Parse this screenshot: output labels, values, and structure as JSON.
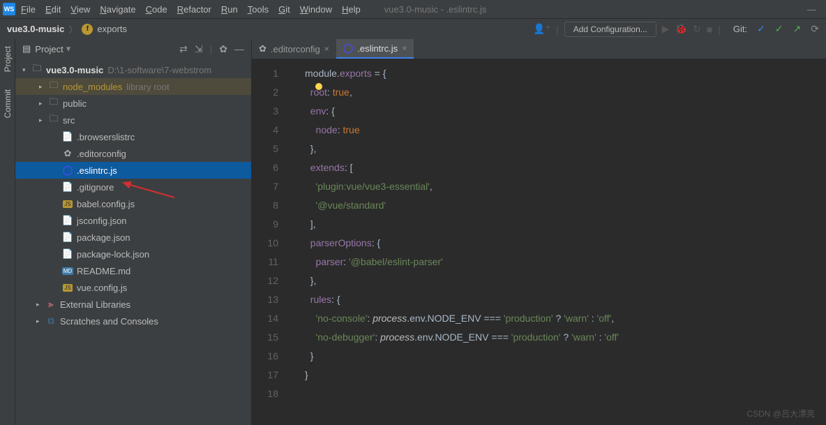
{
  "menubar": {
    "items": [
      "File",
      "Edit",
      "View",
      "Navigate",
      "Code",
      "Refactor",
      "Run",
      "Tools",
      "Git",
      "Window",
      "Help"
    ],
    "title": "vue3.0-music - .eslintrc.js"
  },
  "nav": {
    "project": "vue3.0-music",
    "symbol": "exports",
    "addconfig": "Add Configuration...",
    "git": "Git:"
  },
  "sidebar": {
    "tabs": [
      "Project",
      "Commit"
    ]
  },
  "project": {
    "header": "Project",
    "root": {
      "name": "vue3.0-music",
      "path": "D:\\1-software\\7-webstrom"
    },
    "children": [
      {
        "name": "node_modules",
        "suffix": "library root",
        "type": "dir-lib"
      },
      {
        "name": "public",
        "type": "dir"
      },
      {
        "name": "src",
        "type": "dir"
      },
      {
        "name": ".browserslistrc",
        "type": "file"
      },
      {
        "name": ".editorconfig",
        "type": "gear"
      },
      {
        "name": ".eslintrc.js",
        "type": "eslint",
        "selected": true
      },
      {
        "name": ".gitignore",
        "type": "file"
      },
      {
        "name": "babel.config.js",
        "type": "js"
      },
      {
        "name": "jsconfig.json",
        "type": "json"
      },
      {
        "name": "package.json",
        "type": "json"
      },
      {
        "name": "package-lock.json",
        "type": "json"
      },
      {
        "name": "README.md",
        "type": "md"
      },
      {
        "name": "vue.config.js",
        "type": "js"
      }
    ],
    "extras": [
      "External Libraries",
      "Scratches and Consoles"
    ]
  },
  "tabs": [
    {
      "name": ".editorconfig",
      "icon": "gear"
    },
    {
      "name": ".eslintrc.js",
      "icon": "eslint",
      "active": true
    }
  ],
  "code": {
    "lines": [
      [
        {
          "t": "module",
          "c": "id"
        },
        {
          "t": ".",
          "c": "op"
        },
        {
          "t": "exports",
          "c": "prop"
        },
        {
          "t": " = {",
          "c": "op"
        }
      ],
      [
        {
          "t": "  root",
          "c": "prop"
        },
        {
          "t": ": ",
          "c": "op"
        },
        {
          "t": "true",
          "c": "kw"
        },
        {
          "t": ",",
          "c": "op"
        }
      ],
      [
        {
          "t": "  env",
          "c": "prop"
        },
        {
          "t": ": {",
          "c": "op"
        }
      ],
      [
        {
          "t": "    node",
          "c": "prop"
        },
        {
          "t": ": ",
          "c": "op"
        },
        {
          "t": "true",
          "c": "kw"
        }
      ],
      [
        {
          "t": "  },",
          "c": "op"
        }
      ],
      [
        {
          "t": "  extends",
          "c": "prop"
        },
        {
          "t": ": [",
          "c": "op"
        }
      ],
      [
        {
          "t": "    'plugin:vue/vue3-essential'",
          "c": "str"
        },
        {
          "t": ",",
          "c": "op"
        }
      ],
      [
        {
          "t": "    '@vue/standard'",
          "c": "str"
        }
      ],
      [
        {
          "t": "  ],",
          "c": "op"
        }
      ],
      [
        {
          "t": "  parserOptions",
          "c": "prop"
        },
        {
          "t": ": {",
          "c": "op"
        }
      ],
      [
        {
          "t": "    parser",
          "c": "prop"
        },
        {
          "t": ": ",
          "c": "op"
        },
        {
          "t": "'@babel/eslint-parser'",
          "c": "str"
        }
      ],
      [
        {
          "t": "  },",
          "c": "op"
        }
      ],
      [
        {
          "t": "  rules",
          "c": "prop"
        },
        {
          "t": ": {",
          "c": "op"
        }
      ],
      [
        {
          "t": "    'no-console'",
          "c": "str"
        },
        {
          "t": ": ",
          "c": "op"
        },
        {
          "t": "process",
          "c": "it"
        },
        {
          "t": ".env.NODE_ENV === ",
          "c": "op"
        },
        {
          "t": "'production'",
          "c": "str"
        },
        {
          "t": " ? ",
          "c": "op"
        },
        {
          "t": "'warn'",
          "c": "str"
        },
        {
          "t": " : ",
          "c": "op"
        },
        {
          "t": "'off'",
          "c": "str"
        },
        {
          "t": ",",
          "c": "op"
        }
      ],
      [
        {
          "t": "    'no-debugger'",
          "c": "str"
        },
        {
          "t": ": ",
          "c": "op"
        },
        {
          "t": "process",
          "c": "it"
        },
        {
          "t": ".env.NODE_ENV === ",
          "c": "op"
        },
        {
          "t": "'production'",
          "c": "str"
        },
        {
          "t": " ? ",
          "c": "op"
        },
        {
          "t": "'warn'",
          "c": "str"
        },
        {
          "t": " : ",
          "c": "op"
        },
        {
          "t": "'off'",
          "c": "str"
        }
      ],
      [
        {
          "t": "  }",
          "c": "op"
        }
      ],
      [
        {
          "t": "}",
          "c": "op"
        }
      ],
      [
        {
          "t": "",
          "c": "op"
        }
      ]
    ]
  },
  "watermark": "CSDN @吕大漂亮"
}
